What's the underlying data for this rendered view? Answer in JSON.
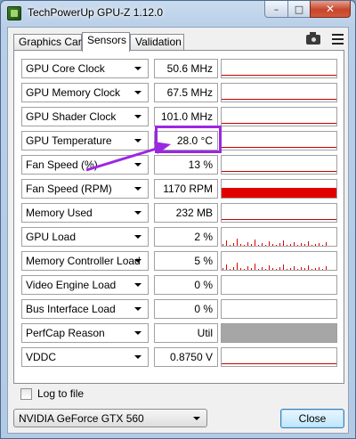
{
  "window": {
    "title": "TechPowerUp GPU-Z 1.12.0",
    "minimize_glyph": "–",
    "maximize_glyph": "□",
    "close_glyph": "✕"
  },
  "tabs": [
    {
      "label": "Graphics Card",
      "active": false
    },
    {
      "label": "Sensors",
      "active": true
    },
    {
      "label": "Validation",
      "active": false
    }
  ],
  "toolbar": {
    "camera_icon": "camera-icon",
    "menu_icon": "hamburger-menu-icon"
  },
  "sensors": [
    {
      "name": "GPU Core Clock",
      "value": "50.6 MHz",
      "graph": "line"
    },
    {
      "name": "GPU Memory Clock",
      "value": "67.5 MHz",
      "graph": "line"
    },
    {
      "name": "GPU Shader Clock",
      "value": "101.0 MHz",
      "graph": "line"
    },
    {
      "name": "GPU Temperature",
      "value": "28.0 °C",
      "graph": "line"
    },
    {
      "name": "Fan Speed (%)",
      "value": "13 %",
      "graph": "line"
    },
    {
      "name": "Fan Speed (RPM)",
      "value": "1170 RPM",
      "graph": "fill"
    },
    {
      "name": "Memory Used",
      "value": "232 MB",
      "graph": "line"
    },
    {
      "name": "GPU Load",
      "value": "2 %",
      "graph": "spikes"
    },
    {
      "name": "Memory Controller Load",
      "value": "5 %",
      "graph": "spikes"
    },
    {
      "name": "Video Engine Load",
      "value": "0 %",
      "graph": "empty"
    },
    {
      "name": "Bus Interface Load",
      "value": "0 %",
      "graph": "empty"
    },
    {
      "name": "PerfCap Reason",
      "value": "Util",
      "graph": "gray"
    },
    {
      "name": "VDDC",
      "value": "0.8750 V",
      "graph": "line"
    }
  ],
  "highlight": {
    "target": "GPU Temperature value",
    "color": "#9c27e3"
  },
  "log_to_file": {
    "label": "Log to file",
    "checked": false
  },
  "gpu_select": {
    "selected": "NVIDIA GeForce GTX 560"
  },
  "close_button": {
    "label": "Close"
  }
}
